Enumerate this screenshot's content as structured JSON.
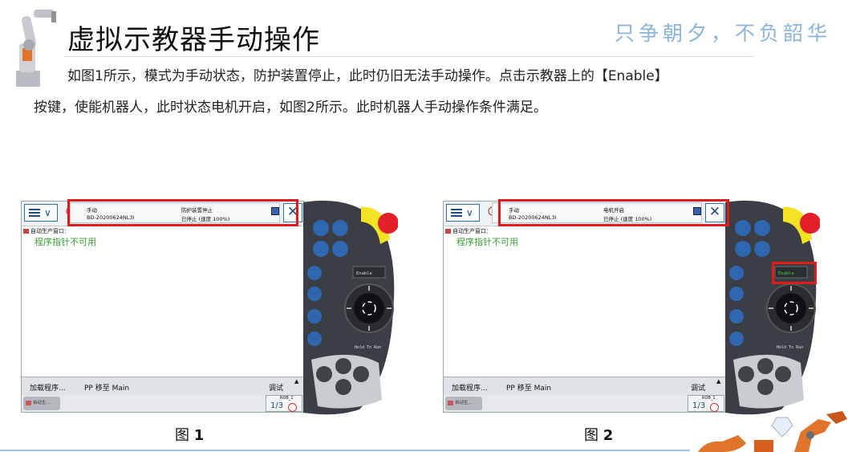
{
  "header": {
    "title": "虚拟示教器手动操作",
    "motto": "只争朝夕，不负韶华"
  },
  "body": {
    "paragraph_line1": "如图1所示，模式为手动状态，防护装置停止，此时仍旧无法手动操作。点击示教器上的【Enable】",
    "paragraph_line2": "按键，使能机器人，此时状态电机开启，如图2所示。此时机器人手动操作条件满足。"
  },
  "figures": [
    {
      "caption_prefix": "图 ",
      "caption_num": "1",
      "status_mode": "手动",
      "status_device": "BD-20200624NL3I",
      "status_state": "防护装置停止",
      "status_speed": "已停止 (速度 100%)",
      "breadcrumb": "自动生产窗口：",
      "pp_note": "程序指针不可用",
      "load_program": "加载程序...",
      "pp_to_main": "PP 移至 Main",
      "debug": "调试",
      "taskbar_button": "自动生...",
      "quickset_robot": "ROB_1",
      "quickset_fraction": "1/3",
      "enable_label": "Enable",
      "hold_label": "Hold To Run",
      "enable_highlight": false
    },
    {
      "caption_prefix": "图 ",
      "caption_num": "2",
      "status_mode": "手动",
      "status_device": "BD-20200624NL3I",
      "status_state": "电机开启",
      "status_speed": "已停止 (速度 100%)",
      "breadcrumb": "自动生产窗口：",
      "pp_note": "程序指针不可用",
      "load_program": "加载程序...",
      "pp_to_main": "PP 移至 Main",
      "debug": "调试",
      "taskbar_button": "自动生...",
      "quickset_robot": "ROB_1",
      "quickset_fraction": "1/3",
      "enable_label": "Enable",
      "hold_label": "Hold To Run",
      "enable_highlight": true
    }
  ],
  "colors": {
    "highlight_red": "#e01b1b",
    "motto_blue": "#8ab4dc",
    "device_grey": "#3b3e44",
    "button_blue": "#2f66b0",
    "estop_red": "#e3202a",
    "guard_yellow": "#f4e224",
    "enable_green": "#43d14a"
  },
  "icons": [
    "robot-arm-logo",
    "menu-icon",
    "close-icon",
    "status-icon",
    "emergency-stop-icon",
    "joystick-icon",
    "robot-arm-decoration-icon"
  ]
}
